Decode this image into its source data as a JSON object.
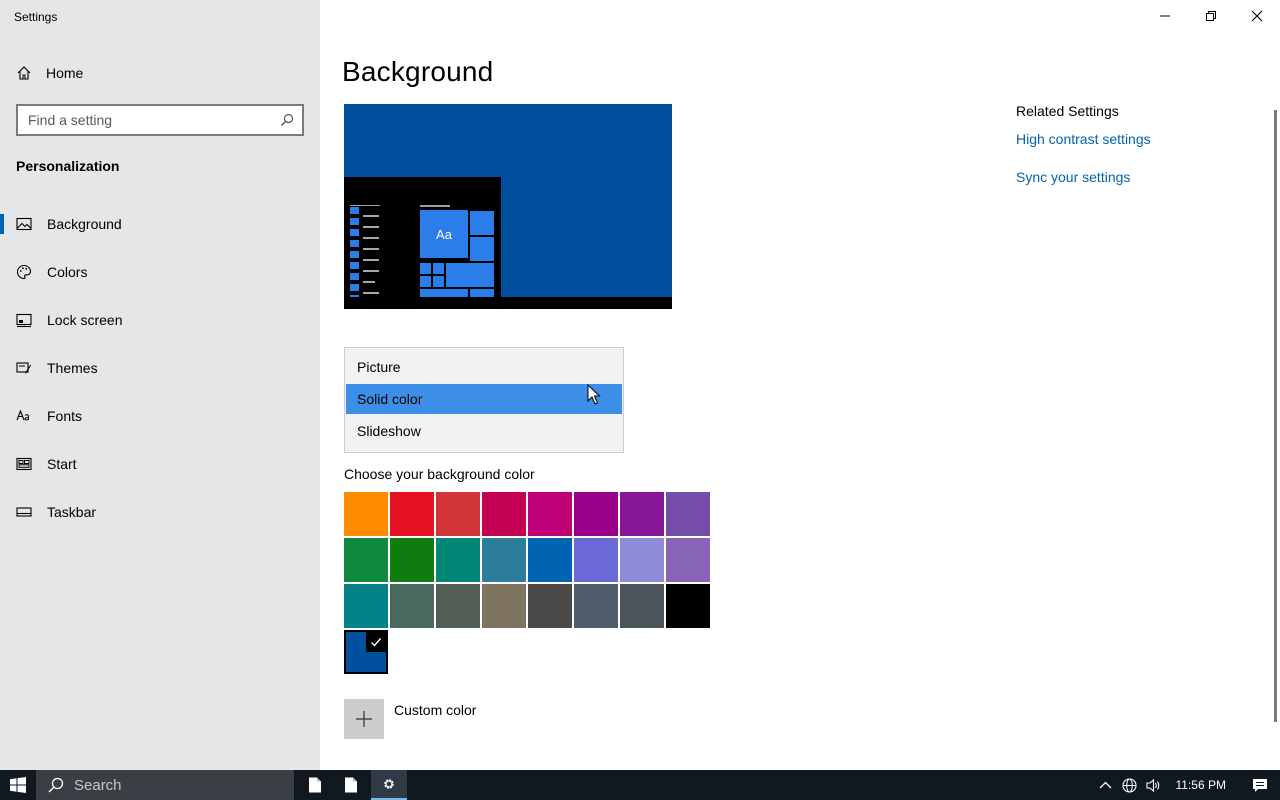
{
  "window": {
    "title": "Settings"
  },
  "sidebar": {
    "home_label": "Home",
    "search_placeholder": "Find a setting",
    "section_title": "Personalization",
    "items": [
      {
        "label": "Background",
        "icon": "image-icon",
        "active": true
      },
      {
        "label": "Colors",
        "icon": "palette-icon"
      },
      {
        "label": "Lock screen",
        "icon": "lock-screen-icon"
      },
      {
        "label": "Themes",
        "icon": "themes-icon"
      },
      {
        "label": "Fonts",
        "icon": "fonts-icon"
      },
      {
        "label": "Start",
        "icon": "start-icon"
      },
      {
        "label": "Taskbar",
        "icon": "taskbar-icon"
      }
    ]
  },
  "main": {
    "title": "Background",
    "preview": {
      "tile_text": "Aa",
      "background": "#00509e"
    },
    "background_dropdown": {
      "options": [
        "Picture",
        "Solid color",
        "Slideshow"
      ],
      "selected": "Solid color"
    },
    "color_section_label": "Choose your background color",
    "colors": [
      "#ff8c00",
      "#e81123",
      "#d13438",
      "#c30052",
      "#bf0077",
      "#9a0089",
      "#881798",
      "#744da9",
      "#10893e",
      "#107c10",
      "#018574",
      "#2d7d9a",
      "#0063b1",
      "#6b69d6",
      "#8e8cd8",
      "#8764b8",
      "#038387",
      "#486860",
      "#525e54",
      "#7e735f",
      "#4c4a48",
      "#515c6b",
      "#4a5459",
      "#000000",
      "#00509e"
    ],
    "selected_color": "#00509e",
    "custom_color_label": "Custom color"
  },
  "related": {
    "title": "Related Settings",
    "links": [
      "High contrast settings",
      "Sync your settings"
    ]
  },
  "taskbar": {
    "search_text": "Search",
    "time": "11:56 PM"
  }
}
